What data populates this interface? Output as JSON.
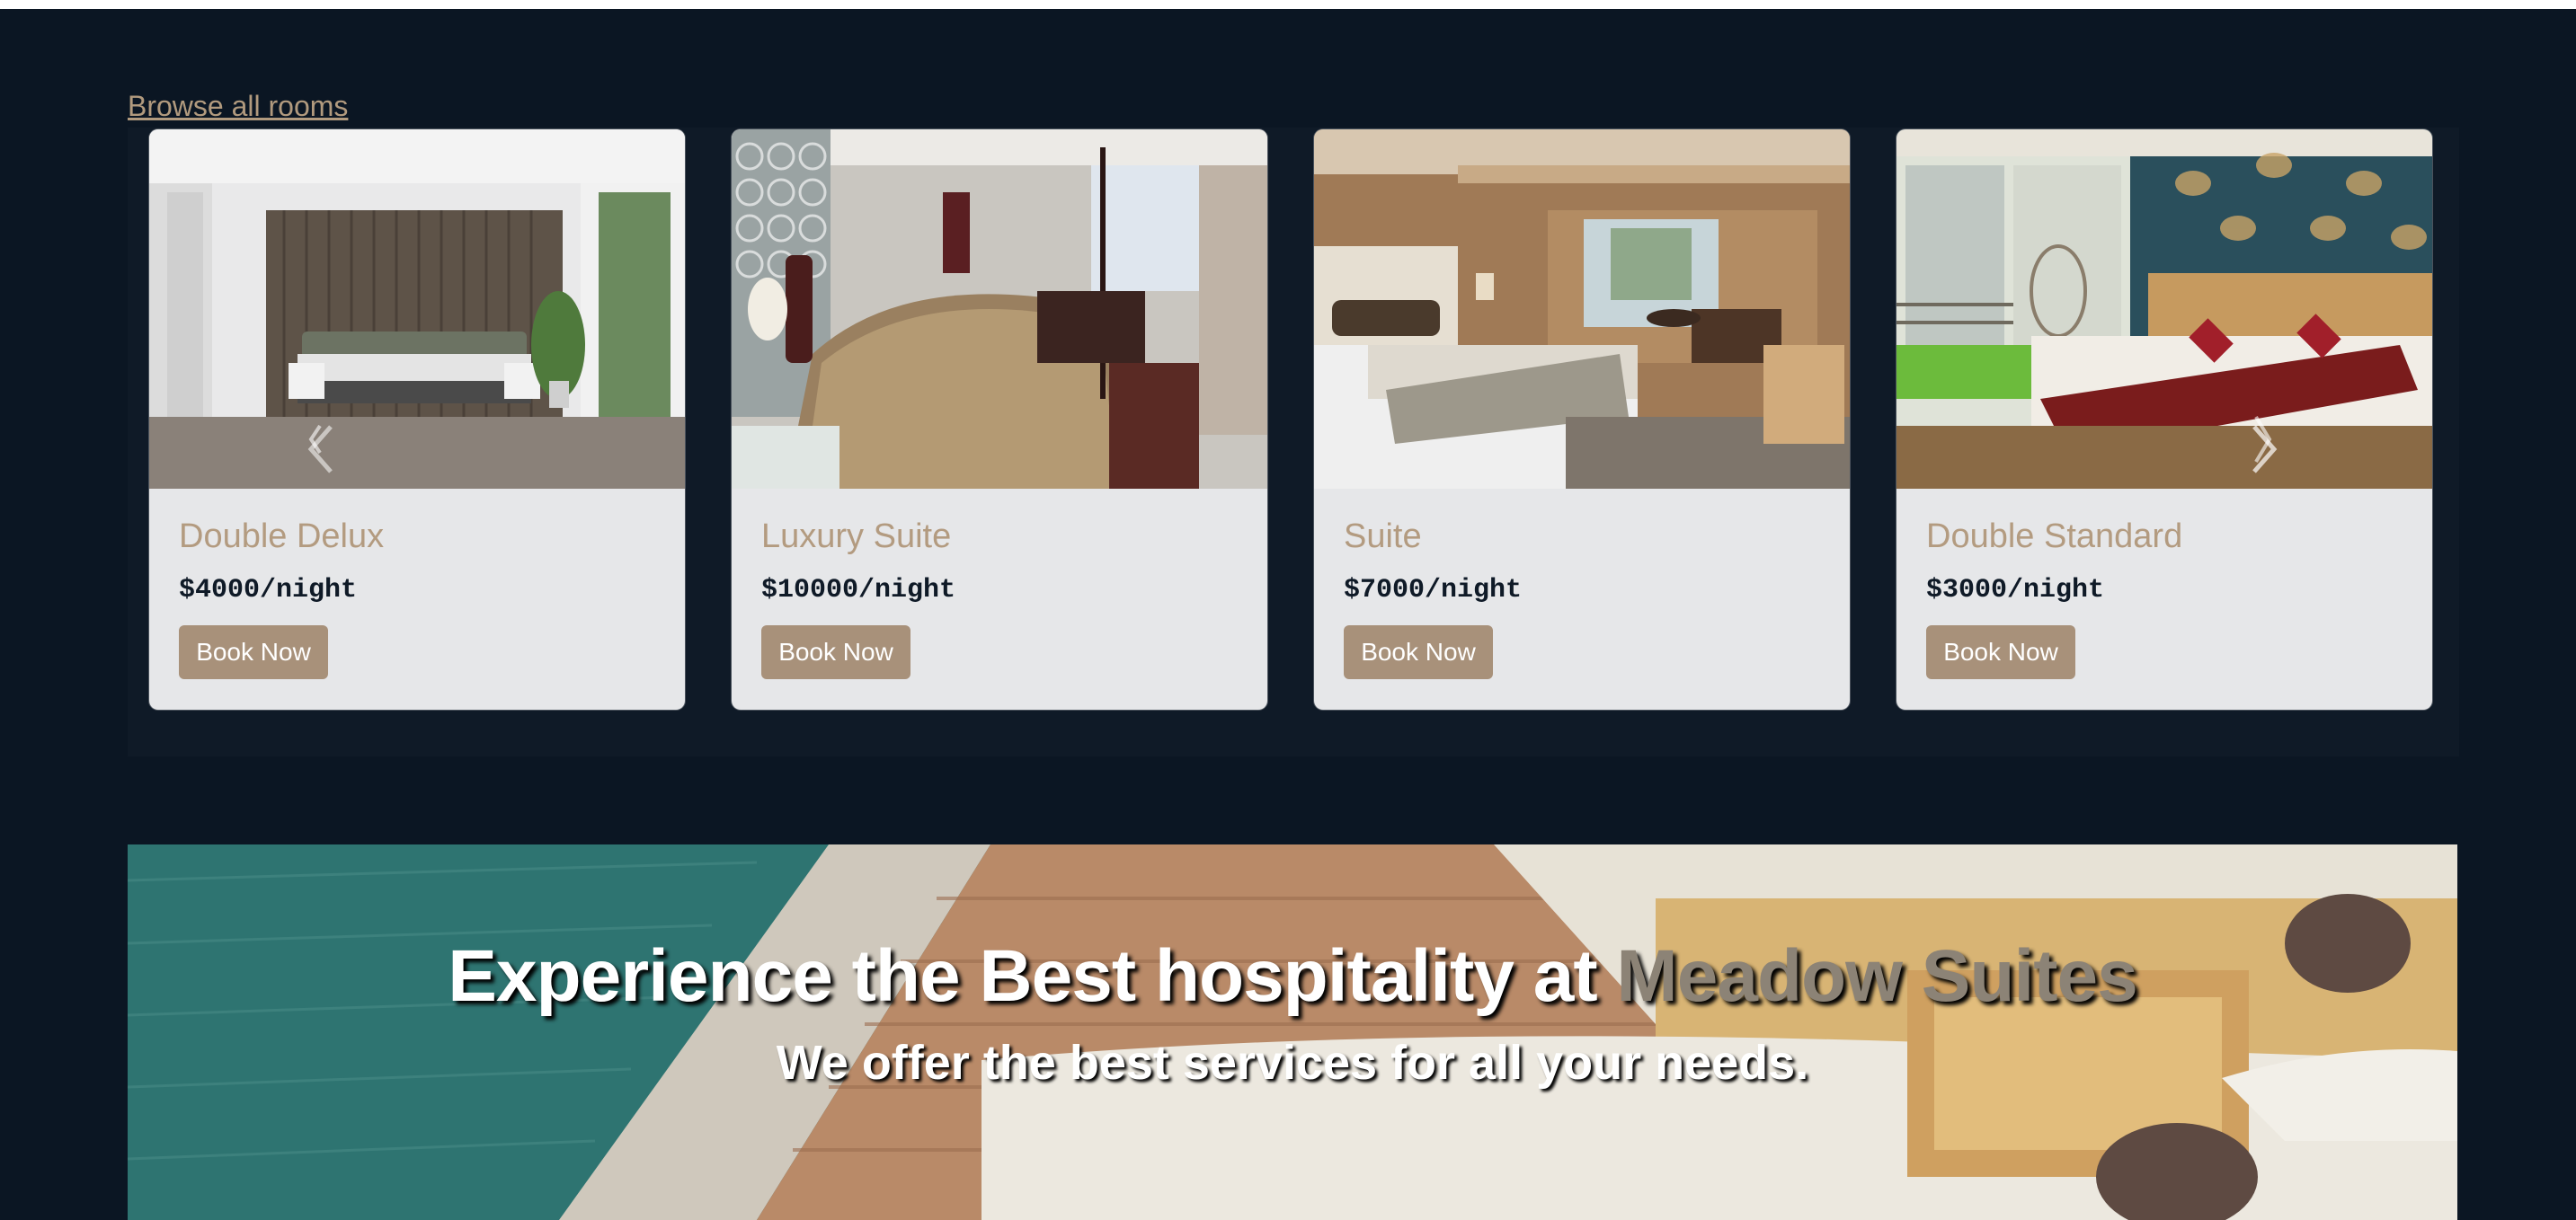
{
  "browse_link": "Browse all rooms",
  "rooms": [
    {
      "name": "Double Delux",
      "price": "$4000/night",
      "button": "Book Now"
    },
    {
      "name": "Luxury Suite",
      "price": "$10000/night",
      "button": "Book Now"
    },
    {
      "name": "Suite",
      "price": "$7000/night",
      "button": "Book Now"
    },
    {
      "name": "Double Standard",
      "price": "$3000/night",
      "button": "Book Now"
    }
  ],
  "carousel": {
    "prev_icon": "chevron-left-icon",
    "next_icon": "chevron-right-icon"
  },
  "hero": {
    "title_prefix": "Experience the Best hospitality at ",
    "title_accent": "Meadow Suites",
    "subtitle": "We offer the best services for all your needs."
  },
  "colors": {
    "background": "#0b1623",
    "accent": "#b39b80",
    "button": "#a8917a",
    "card": "#e6e7e9",
    "hero_accent": "#8c8376"
  }
}
